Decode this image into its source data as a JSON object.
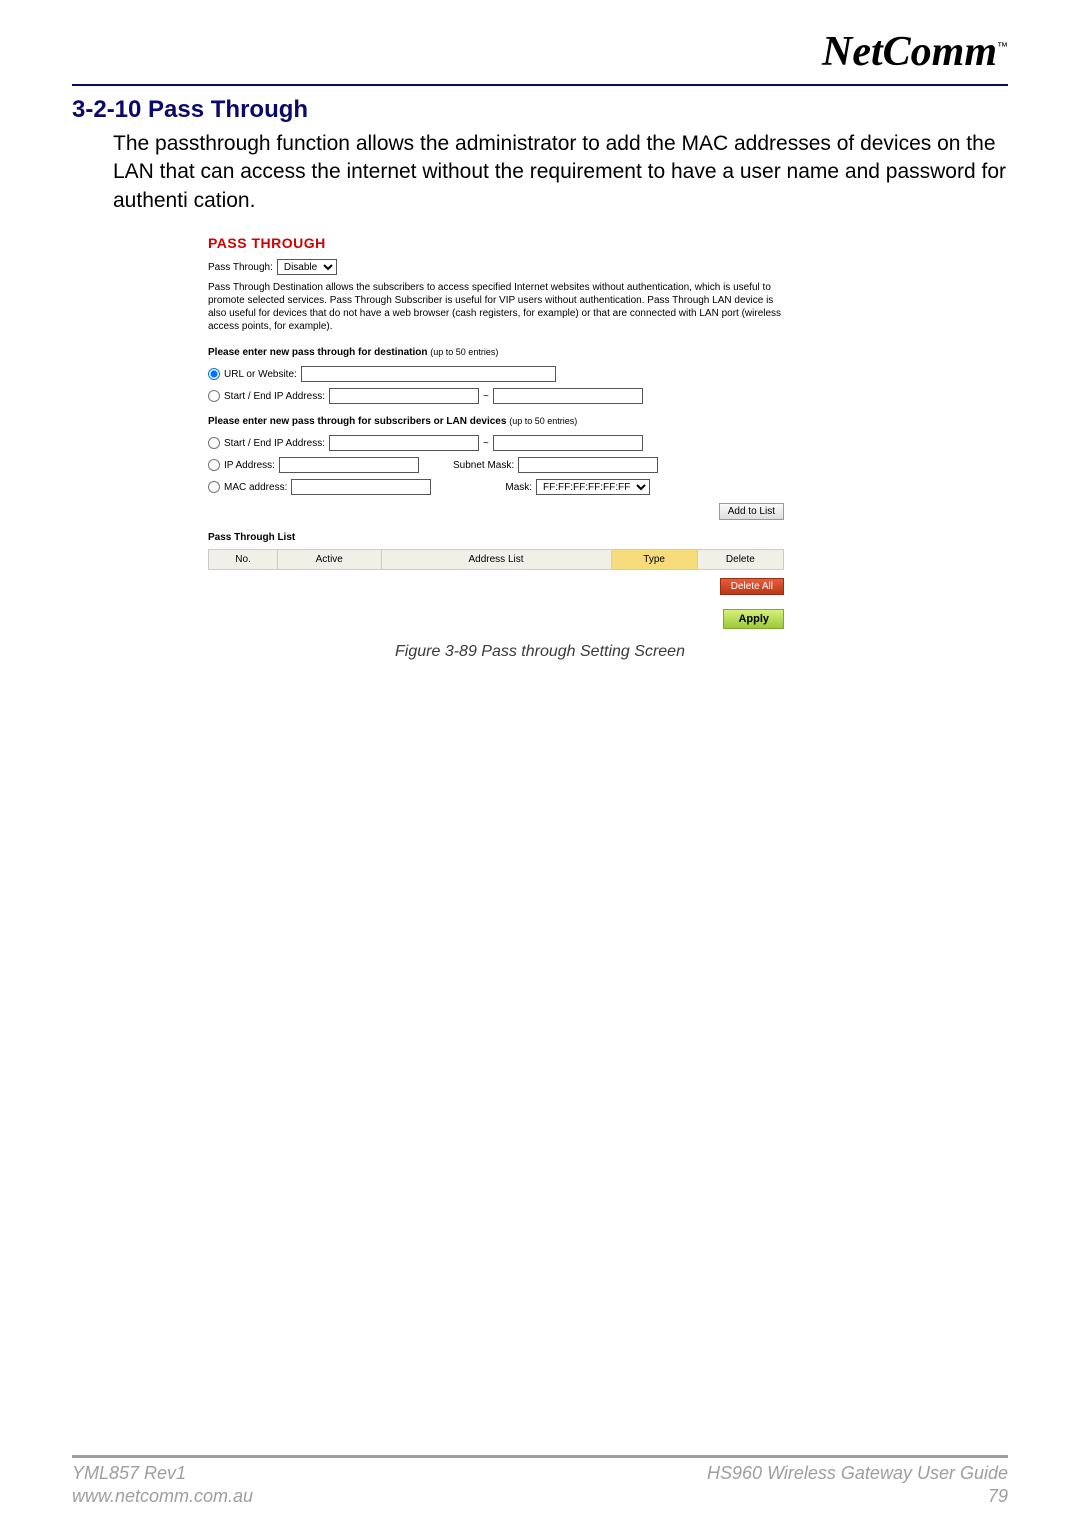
{
  "header": {
    "logo_text": "NetComm",
    "logo_tm": "™"
  },
  "content": {
    "section_title": "3-2-10 Pass Through",
    "body_text": "The passthrough function allows the administrator to add the MAC addresses of devices on the LAN that can access the internet without the requirement to have a user name and password for authenti cation."
  },
  "screenshot": {
    "panel_title": "PASS THROUGH",
    "pt_label": "Pass Through:",
    "pt_select": "Disable",
    "description": "Pass Through Destination allows the subscribers to access specified Internet websites without authentication, which is useful to promote selected services. Pass Through Subscriber is useful for VIP users without authentication. Pass Through LAN device is also useful for devices that do not have a web browser (cash registers, for example) or that are connected with LAN port (wireless access points, for example).",
    "dest_heading": "Please enter new pass through for destination",
    "dest_limit": "(up to 50 entries)",
    "opt_url": "URL or Website:",
    "opt_ip_range1": "Start / End IP Address:",
    "subs_heading": "Please enter new pass through for subscribers or LAN devices",
    "subs_limit": "(up to 50 entries)",
    "opt_ip_range2": "Start / End IP Address:",
    "opt_ip_addr": "IP Address:",
    "subnet_mask_label": "Subnet Mask:",
    "opt_mac": "MAC address:",
    "mask_label": "Mask:",
    "mask_select": "FF:FF:FF:FF:FF:FF",
    "btn_add": "Add to List",
    "list_title": "Pass Through List",
    "cols": {
      "no": "No.",
      "active": "Active",
      "address": "Address List",
      "type": "Type",
      "delete": "Delete"
    },
    "btn_delete_all": "Delete All",
    "btn_apply": "Apply"
  },
  "caption": "Figure 3-89 Pass through Setting Screen",
  "footer": {
    "left_line1": "YML857 Rev1",
    "left_line2": "www.netcomm.com.au",
    "right_line1": "HS960 Wireless Gateway User Guide",
    "right_line2": "79"
  }
}
